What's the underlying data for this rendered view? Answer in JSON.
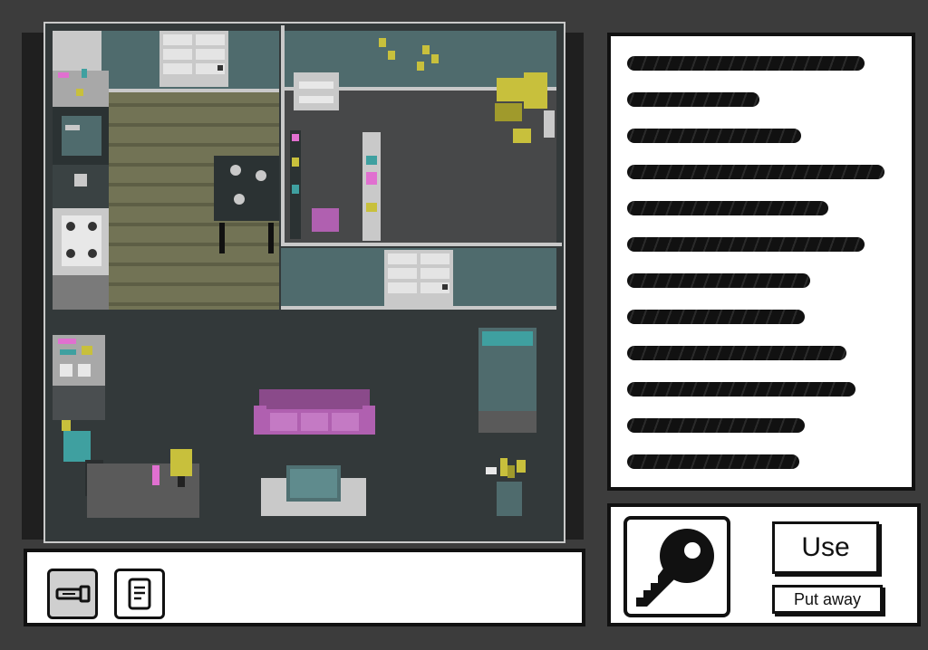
{
  "scene": {
    "name": "apartment-room",
    "colors": {
      "wall": "#4f6b6d",
      "floor": "#33393a",
      "wood_floor": "#727355",
      "sofa": "#b060b0",
      "accent_yellow": "#c8c03c",
      "accent_pink": "#e070d0",
      "accent_teal": "#3fa0a0"
    }
  },
  "message_panel": {
    "text_state": "scribbled-out",
    "line_count": 12
  },
  "inventory": {
    "items": [
      {
        "icon": "flashlight-icon",
        "selected": true
      },
      {
        "icon": "note-icon",
        "selected": false
      }
    ]
  },
  "action_panel": {
    "selected_item_icon": "key-icon",
    "use_label": "Use",
    "put_away_label": "Put away"
  }
}
